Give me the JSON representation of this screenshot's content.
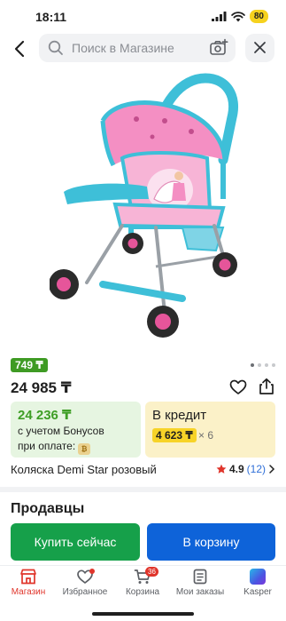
{
  "status_bar": {
    "time": "18:11",
    "battery": "80"
  },
  "search": {
    "placeholder": "Поиск в Магазине"
  },
  "product": {
    "badge_price": "749 ₸",
    "price": "24 985 ₸",
    "title": "Коляска Demi Star розовый",
    "rating": "4.9",
    "reviews": "(12)"
  },
  "bonus": {
    "price": "24 236 ₸",
    "line1": "с учетом Бонусов",
    "line2": "при оплате:"
  },
  "credit": {
    "title": "В кредит",
    "monthly": "4 623 ₸",
    "multiplier": "× 6"
  },
  "sellers": {
    "heading": "Продавцы"
  },
  "actions": {
    "buy_now": "Купить сейчас",
    "to_cart": "В корзину"
  },
  "tabbar": {
    "shop": "Магазин",
    "favorites": "Избранное",
    "cart": "Корзина",
    "cart_badge": "36",
    "orders": "Мои заказы",
    "kaspi": "Kasper"
  },
  "colors": {
    "green": "#16a04a",
    "blue": "#0e63d9",
    "accent_red": "#e0352b",
    "credit_yellow": "#f7d328"
  }
}
